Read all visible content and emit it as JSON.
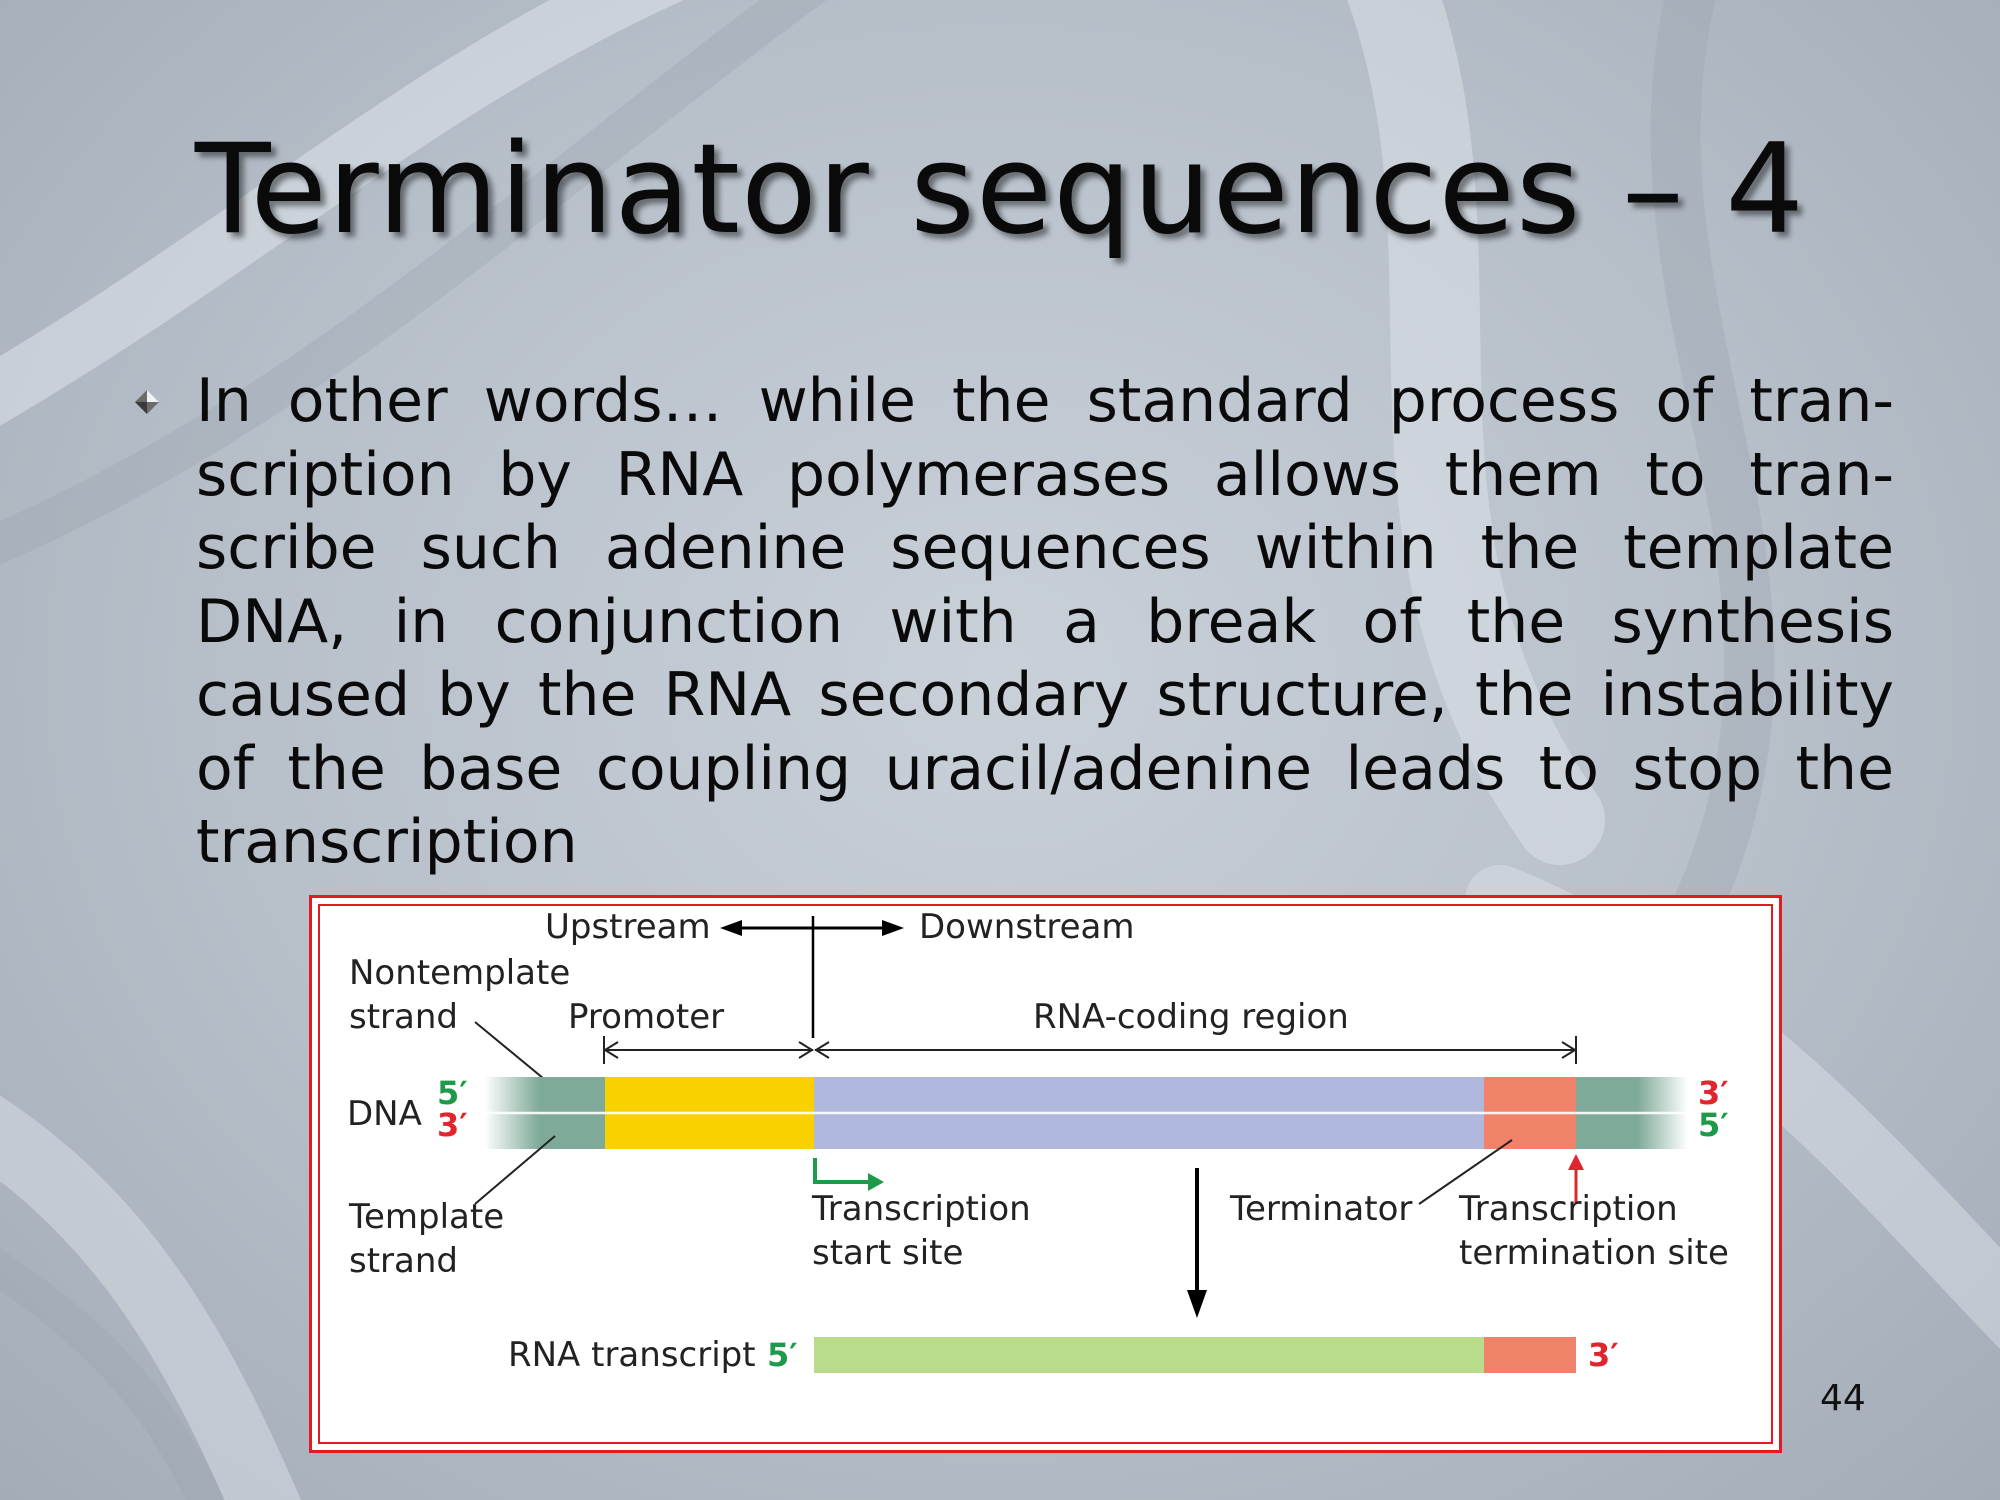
{
  "slide": {
    "title": "Terminator sequences – 4",
    "bullet": "In other words… while the standard process of tran-scription by RNA polymerases allows them to tran-scribe such adenine sequences within the template DNA, in conjunction with a break of the synthesis caused by the RNA secondary structure, the instability of the base coupling uracil/adenine leads to stop the transcription",
    "page_number": "44",
    "bullet_icon": "diamond-bullet-icon"
  },
  "diagram": {
    "upstream": "Upstream",
    "downstream": "Downstream",
    "nontemplate_line1": "Nontemplate",
    "nontemplate_line2": "strand",
    "promoter": "Promoter",
    "coding_region": "RNA-coding region",
    "dna": "DNA",
    "five_prime": "5′",
    "three_prime": "3′",
    "template_line1": "Template",
    "template_line2": "strand",
    "start_site_line1": "Transcription",
    "start_site_line2": "start site",
    "terminator": "Terminator",
    "termination_line1": "Transcription",
    "termination_line2": "termination site",
    "rna_transcript": "RNA transcript",
    "colors": {
      "promoter": "#f9d100",
      "coding": "#b1b8de",
      "terminator": "#f0826a",
      "flank": "#7faa99",
      "transcript": "#b9db8c",
      "green_label": "#1f9a4b",
      "red_label": "#e1252e",
      "frame": "#e21b23"
    }
  }
}
